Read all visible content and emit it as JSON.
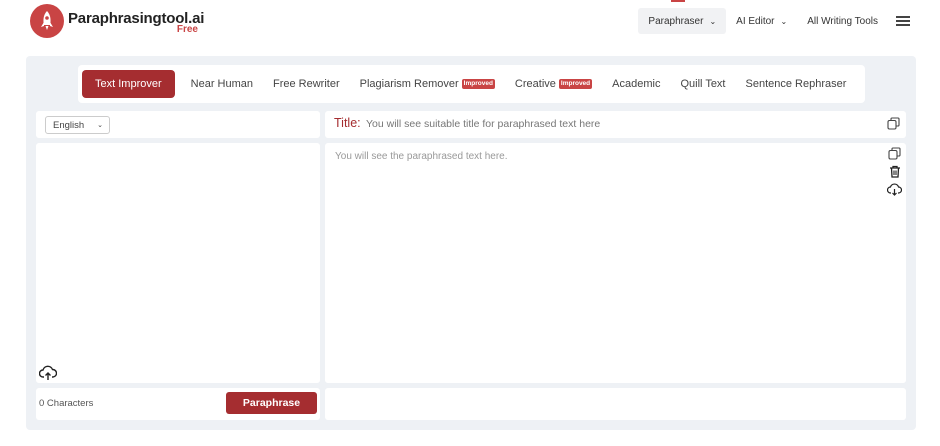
{
  "brand": {
    "name": "Paraphrasingtool.ai",
    "tagline": "Free",
    "accent": "#a52d30",
    "logo_color": "#c94444"
  },
  "topnav": {
    "items": [
      {
        "label": "Paraphraser",
        "dropdown": true,
        "active": true
      },
      {
        "label": "AI Editor",
        "dropdown": true,
        "active": false
      },
      {
        "label": "All Writing Tools",
        "dropdown": false,
        "active": false
      }
    ],
    "menu_icon": "hamburger-icon"
  },
  "modes": {
    "tabs": [
      {
        "label": "Text Improver",
        "active": true,
        "badge": ""
      },
      {
        "label": "Near Human",
        "active": false,
        "badge": ""
      },
      {
        "label": "Free Rewriter",
        "active": false,
        "badge": ""
      },
      {
        "label": "Plagiarism Remover",
        "active": false,
        "badge": "Improved"
      },
      {
        "label": "Creative",
        "active": false,
        "badge": "Improved"
      },
      {
        "label": "Academic",
        "active": false,
        "badge": ""
      },
      {
        "label": "Quill Text",
        "active": false,
        "badge": ""
      },
      {
        "label": "Sentence Rephraser",
        "active": false,
        "badge": ""
      }
    ]
  },
  "input": {
    "language": "English",
    "text": "",
    "char_count": "0 Characters",
    "upload_icon": "cloud-upload-icon",
    "paraphrase_label": "Paraphrase"
  },
  "output": {
    "title_label": "Title:",
    "title_placeholder": "You will see suitable title for paraphrased text here",
    "placeholder": "You will see the paraphrased text here.",
    "icons": [
      "copy-icon",
      "trash-icon",
      "cloud-download-icon"
    ]
  }
}
